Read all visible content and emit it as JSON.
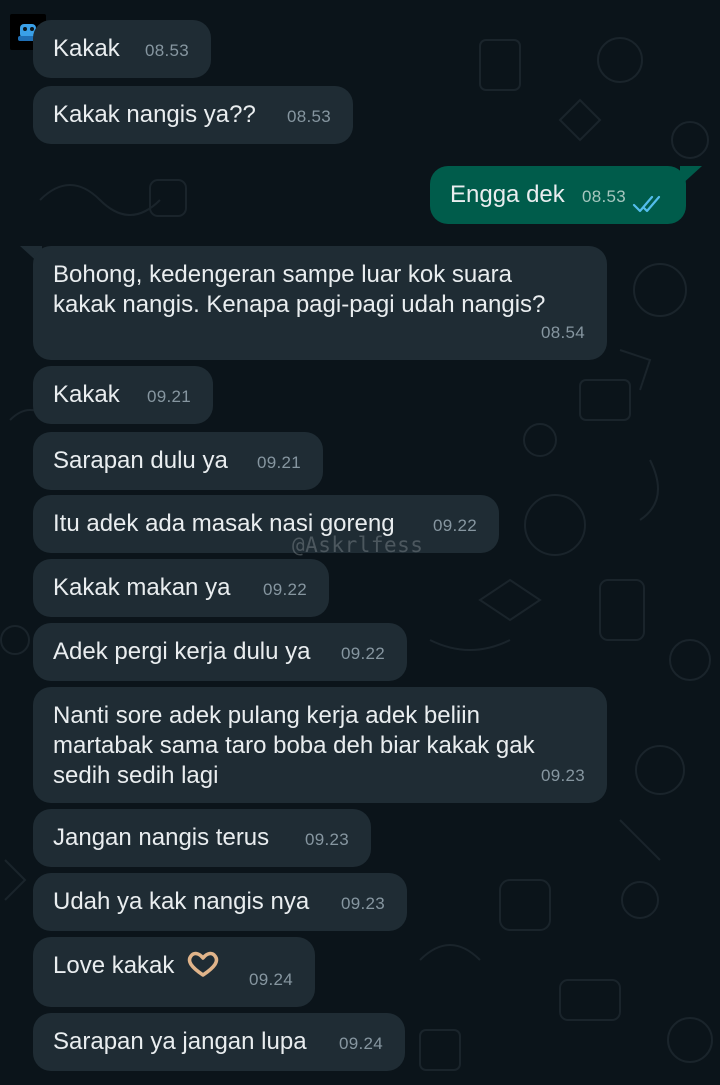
{
  "app": "WhatsApp",
  "theme": {
    "background": "#0b141a",
    "incoming_bubble": "#1f2c34",
    "outgoing_bubble": "#005c4b",
    "text": "#e9edef",
    "timestamp": "#8696a0",
    "read_tick": "#53bdeb"
  },
  "watermark": "@Askrlfess",
  "messages": [
    {
      "text": "Kakak",
      "time": "08.53",
      "direction": "in"
    },
    {
      "text": "Kakak nangis ya??",
      "time": "08.53",
      "direction": "in"
    },
    {
      "text": "Engga dek",
      "time": "08.53",
      "direction": "out",
      "status": "read-ticks-icon"
    },
    {
      "text": "Bohong, kedengeran sampe luar kok suara\nkakak nangis. Kenapa pagi-pagi udah nangis?",
      "time": "08.54",
      "direction": "in"
    },
    {
      "text": "Kakak",
      "time": "09.21",
      "direction": "in"
    },
    {
      "text": "Sarapan dulu ya",
      "time": "09.21",
      "direction": "in"
    },
    {
      "text": "Itu adek ada masak nasi goreng",
      "time": "09.22",
      "direction": "in"
    },
    {
      "text": "Kakak makan ya",
      "time": "09.22",
      "direction": "in"
    },
    {
      "text": "Adek pergi kerja dulu ya",
      "time": "09.22",
      "direction": "in"
    },
    {
      "text": "Nanti sore adek pulang kerja adek beliin\nmartabak sama taro boba deh biar kakak gak\nsedih sedih lagi",
      "time": "09.23",
      "direction": "in"
    },
    {
      "text": "Jangan nangis terus",
      "time": "09.23",
      "direction": "in"
    },
    {
      "text": "Udah ya kak nangis nya",
      "time": "09.23",
      "direction": "in"
    },
    {
      "text": "Love kakak",
      "time": "09.24",
      "direction": "in",
      "emoji": "heart-hands-icon"
    },
    {
      "text": "Sarapan ya jangan lupa",
      "time": "09.24",
      "direction": "in"
    }
  ]
}
